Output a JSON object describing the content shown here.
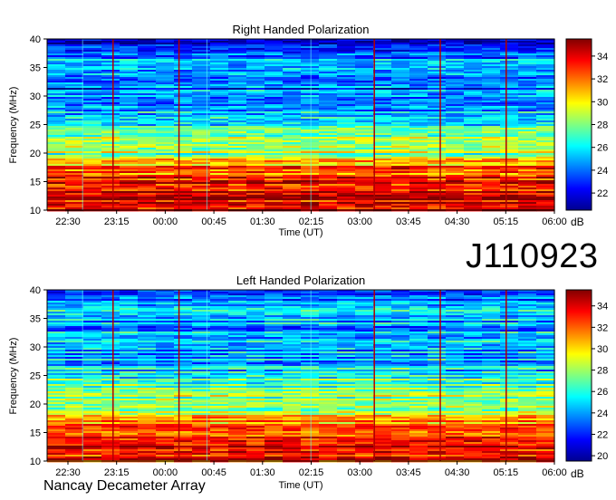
{
  "observation_id": "J110923",
  "instrument": "Nancay Decameter Array",
  "chart_data": [
    {
      "type": "heatmap",
      "title": "Right Handed Polarization",
      "xlabel": "Time (UT)",
      "ylabel": "Frequency (MHz)",
      "x_ticks": [
        "22:30",
        "23:15",
        "00:00",
        "00:45",
        "01:30",
        "02:15",
        "03:00",
        "03:45",
        "04:30",
        "05:15",
        "06:00"
      ],
      "y_ticks": [
        10,
        15,
        20,
        25,
        30,
        35,
        40
      ],
      "ylim": [
        10,
        40
      ],
      "colorbar": {
        "label": "dB",
        "ticks": [
          22,
          24,
          26,
          28,
          30,
          32,
          34
        ],
        "range": [
          20.5,
          35.5
        ]
      },
      "intensity_profile_mhz_db": [
        [
          10,
          34
        ],
        [
          13,
          34
        ],
        [
          16,
          33
        ],
        [
          18,
          31
        ],
        [
          20,
          28
        ],
        [
          22,
          30
        ],
        [
          24,
          27
        ],
        [
          27,
          25
        ],
        [
          30,
          24
        ],
        [
          34,
          24
        ],
        [
          36,
          26
        ],
        [
          38,
          23
        ],
        [
          40,
          21
        ]
      ]
    },
    {
      "type": "heatmap",
      "title": "Left Handed Polarization",
      "xlabel": "Time (UT)",
      "ylabel": "Frequency (MHz)",
      "x_ticks": [
        "22:30",
        "23:15",
        "00:00",
        "00:45",
        "01:30",
        "02:15",
        "03:00",
        "03:45",
        "04:30",
        "05:15",
        "06:00"
      ],
      "y_ticks": [
        10,
        15,
        20,
        25,
        30,
        35,
        40
      ],
      "ylim": [
        10,
        40
      ],
      "colorbar": {
        "label": "dB",
        "ticks": [
          20,
          22,
          24,
          26,
          28,
          30,
          32,
          34
        ],
        "range": [
          19.5,
          35.5
        ]
      },
      "intensity_profile_mhz_db": [
        [
          10,
          34
        ],
        [
          13,
          33
        ],
        [
          16,
          32
        ],
        [
          18,
          30
        ],
        [
          20,
          27
        ],
        [
          22,
          28
        ],
        [
          24,
          26
        ],
        [
          27,
          25
        ],
        [
          30,
          24
        ],
        [
          34,
          24
        ],
        [
          36,
          25
        ],
        [
          38,
          23
        ],
        [
          40,
          21
        ]
      ]
    }
  ]
}
